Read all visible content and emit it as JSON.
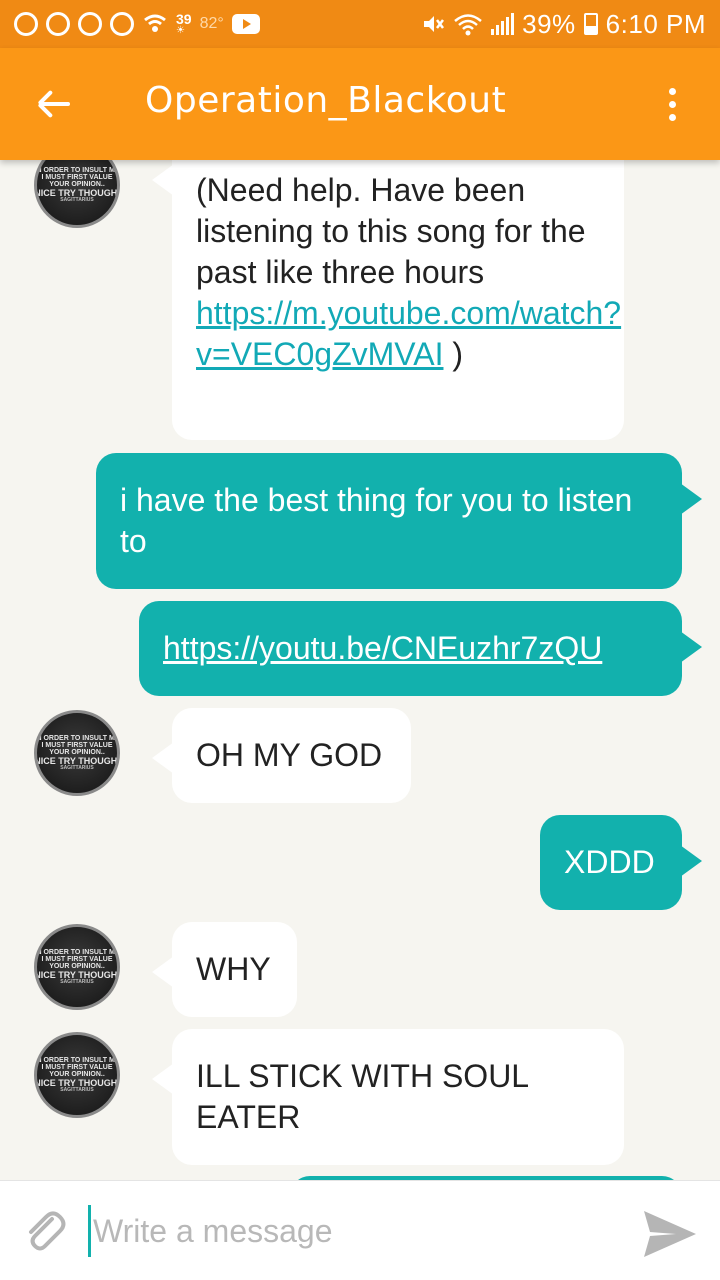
{
  "status_bar": {
    "temp_top": "39",
    "temp_deg": "82°",
    "battery": "39%",
    "time": "6:10 PM",
    "icons": [
      "app-icon",
      "app-icon",
      "pinterest-icon",
      "hangouts-icon",
      "wifi-call-icon",
      "weather-icon",
      "youtube-icon",
      "mute-icon",
      "wifi-icon",
      "signal-icon",
      "battery-icon"
    ]
  },
  "app_bar": {
    "title": "Operation_Blackout",
    "color": "#fb9716"
  },
  "avatar_text": {
    "l1": "IN ORDER TO INSULT ME",
    "l2": "I MUST FIRST VALUE",
    "l3": "YOUR OPINION..",
    "l4": "NICE TRY THOUGH.",
    "l5": "SAGITTARIUS"
  },
  "messages": [
    {
      "side": "in",
      "text": "(Need help. Have been listening to this song for the past like three hours ",
      "link": "https://m.youtube.com/watch?v=VEC0gZvMVAI",
      "suffix": " )"
    },
    {
      "side": "out",
      "text": "i have the best thing for you to listen to"
    },
    {
      "side": "out",
      "link": "https://youtu.be/CNEuzhr7zQU"
    },
    {
      "side": "in",
      "text": "OH MY GOD"
    },
    {
      "side": "out",
      "text": "XDDD"
    },
    {
      "side": "in",
      "text": "WHY"
    },
    {
      "side": "in",
      "text": "ILL STICK WITH SOUL EATER"
    }
  ],
  "composer": {
    "placeholder": "Write a message"
  },
  "colors": {
    "status_bar": "#f08a14",
    "outgoing_bubble": "#12b1ad",
    "incoming_bubble": "#ffffff",
    "background": "#f6f5f0"
  }
}
